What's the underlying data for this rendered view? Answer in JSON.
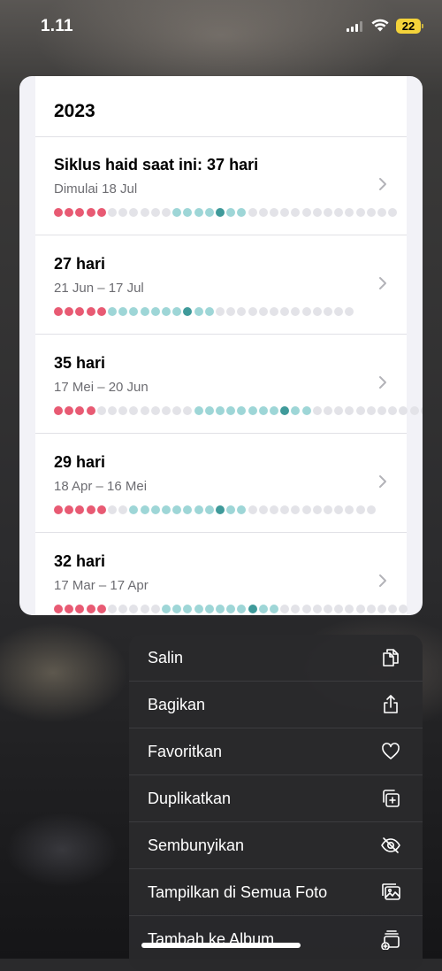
{
  "status": {
    "time": "1.11",
    "battery": "22"
  },
  "card": {
    "year": "2023",
    "cycles": [
      {
        "title": "Siklus haid saat ini: 37 hari",
        "subtitle": "Dimulai 18 Jul",
        "dots": [
          "p",
          "p",
          "p",
          "p",
          "p",
          "g",
          "g",
          "g",
          "g",
          "g",
          "g",
          "t",
          "t",
          "t",
          "t",
          "d",
          "t",
          "t",
          "g",
          "g",
          "g",
          "g",
          "g",
          "g",
          "g",
          "g",
          "g",
          "g",
          "g",
          "g",
          "g",
          "g"
        ]
      },
      {
        "title": "27 hari",
        "subtitle": "21 Jun – 17 Jul",
        "dots": [
          "p",
          "p",
          "p",
          "p",
          "p",
          "t",
          "t",
          "t",
          "t",
          "t",
          "t",
          "t",
          "d",
          "t",
          "t",
          "g",
          "g",
          "g",
          "g",
          "g",
          "g",
          "g",
          "g",
          "g",
          "g",
          "g",
          "g",
          "g"
        ]
      },
      {
        "title": "35 hari",
        "subtitle": "17 Mei – 20 Jun",
        "dots": [
          "p",
          "p",
          "p",
          "p",
          "g",
          "g",
          "g",
          "g",
          "g",
          "g",
          "g",
          "g",
          "g",
          "t",
          "t",
          "t",
          "t",
          "t",
          "t",
          "t",
          "t",
          "d",
          "t",
          "t",
          "g",
          "g",
          "g",
          "g",
          "g",
          "g",
          "g",
          "g",
          "g",
          "g",
          "g",
          "g"
        ]
      },
      {
        "title": "29 hari",
        "subtitle": "18 Apr – 16 Mei",
        "dots": [
          "p",
          "p",
          "p",
          "p",
          "p",
          "g",
          "g",
          "t",
          "t",
          "t",
          "t",
          "t",
          "t",
          "t",
          "t",
          "d",
          "t",
          "t",
          "g",
          "g",
          "g",
          "g",
          "g",
          "g",
          "g",
          "g",
          "g",
          "g",
          "g",
          "g"
        ]
      },
      {
        "title": "32 hari",
        "subtitle": "17 Mar – 17 Apr",
        "dots": [
          "p",
          "p",
          "p",
          "p",
          "p",
          "g",
          "g",
          "g",
          "g",
          "g",
          "t",
          "t",
          "t",
          "t",
          "t",
          "t",
          "t",
          "t",
          "d",
          "t",
          "t",
          "g",
          "g",
          "g",
          "g",
          "g",
          "g",
          "g",
          "g",
          "g",
          "g",
          "g",
          "g"
        ]
      }
    ]
  },
  "colors": {
    "p": "#e85a73",
    "g": "#e3e3e8",
    "t": "#9ed6d7",
    "d": "#3f9a9a"
  },
  "menu": {
    "items": [
      {
        "label": "Salin",
        "icon": "copy-icon"
      },
      {
        "label": "Bagikan",
        "icon": "share-icon"
      },
      {
        "label": "Favoritkan",
        "icon": "heart-icon"
      },
      {
        "label": "Duplikatkan",
        "icon": "duplicate-icon"
      },
      {
        "label": "Sembunyikan",
        "icon": "eye-slash-icon"
      },
      {
        "label": "Tampilkan di Semua Foto",
        "icon": "photos-icon"
      },
      {
        "label": "Tambah ke Album",
        "icon": "add-to-album-icon"
      }
    ]
  }
}
